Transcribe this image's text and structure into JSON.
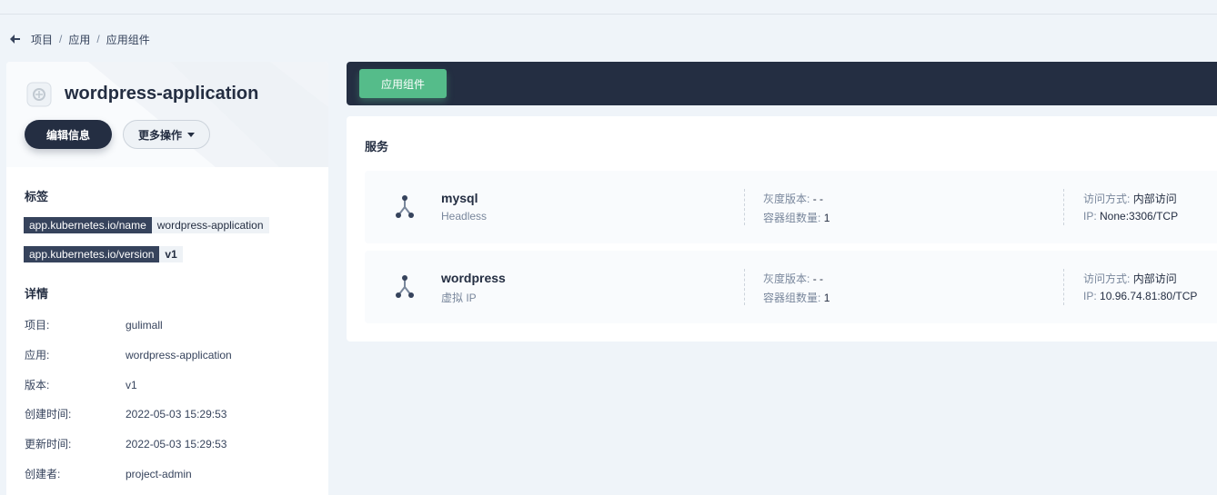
{
  "breadcrumb": {
    "items": [
      "项目",
      "应用",
      "应用组件"
    ],
    "sep": "/"
  },
  "app": {
    "name": "wordpress-application",
    "edit_label": "编辑信息",
    "more_label": "更多操作"
  },
  "labels": {
    "title": "标签",
    "items": [
      {
        "key": "app.kubernetes.io/name",
        "value": "wordpress-application"
      },
      {
        "key": "app.kubernetes.io/version",
        "value": "v1"
      }
    ]
  },
  "details": {
    "title": "详情",
    "rows": [
      {
        "label": "项目:",
        "value": "gulimall"
      },
      {
        "label": "应用:",
        "value": "wordpress-application"
      },
      {
        "label": "版本:",
        "value": "v1"
      },
      {
        "label": "创建时间:",
        "value": "2022-05-03 15:29:53"
      },
      {
        "label": "更新时间:",
        "value": "2022-05-03 15:29:53"
      },
      {
        "label": "创建者:",
        "value": "project-admin"
      }
    ]
  },
  "toolbar": {
    "tab_label": "应用组件"
  },
  "services": {
    "title": "服务",
    "items": [
      {
        "name": "mysql",
        "type": "Headless",
        "gray_label": "灰度版本:",
        "gray_value": "- -",
        "pods_label": "容器组数量:",
        "pods_value": "1",
        "access_label": "访问方式:",
        "access_value": "内部访问",
        "ip_label": "IP:",
        "ip_value": "None:3306/TCP"
      },
      {
        "name": "wordpress",
        "type": "虚拟 IP",
        "gray_label": "灰度版本:",
        "gray_value": "- -",
        "pods_label": "容器组数量:",
        "pods_value": "1",
        "access_label": "访问方式:",
        "access_value": "内部访问",
        "ip_label": "IP:",
        "ip_value": "10.96.74.81:80/TCP"
      }
    ]
  },
  "colors": {
    "dark": "#242e42",
    "accent": "#55bc8a",
    "bg": "#eff4f9"
  }
}
